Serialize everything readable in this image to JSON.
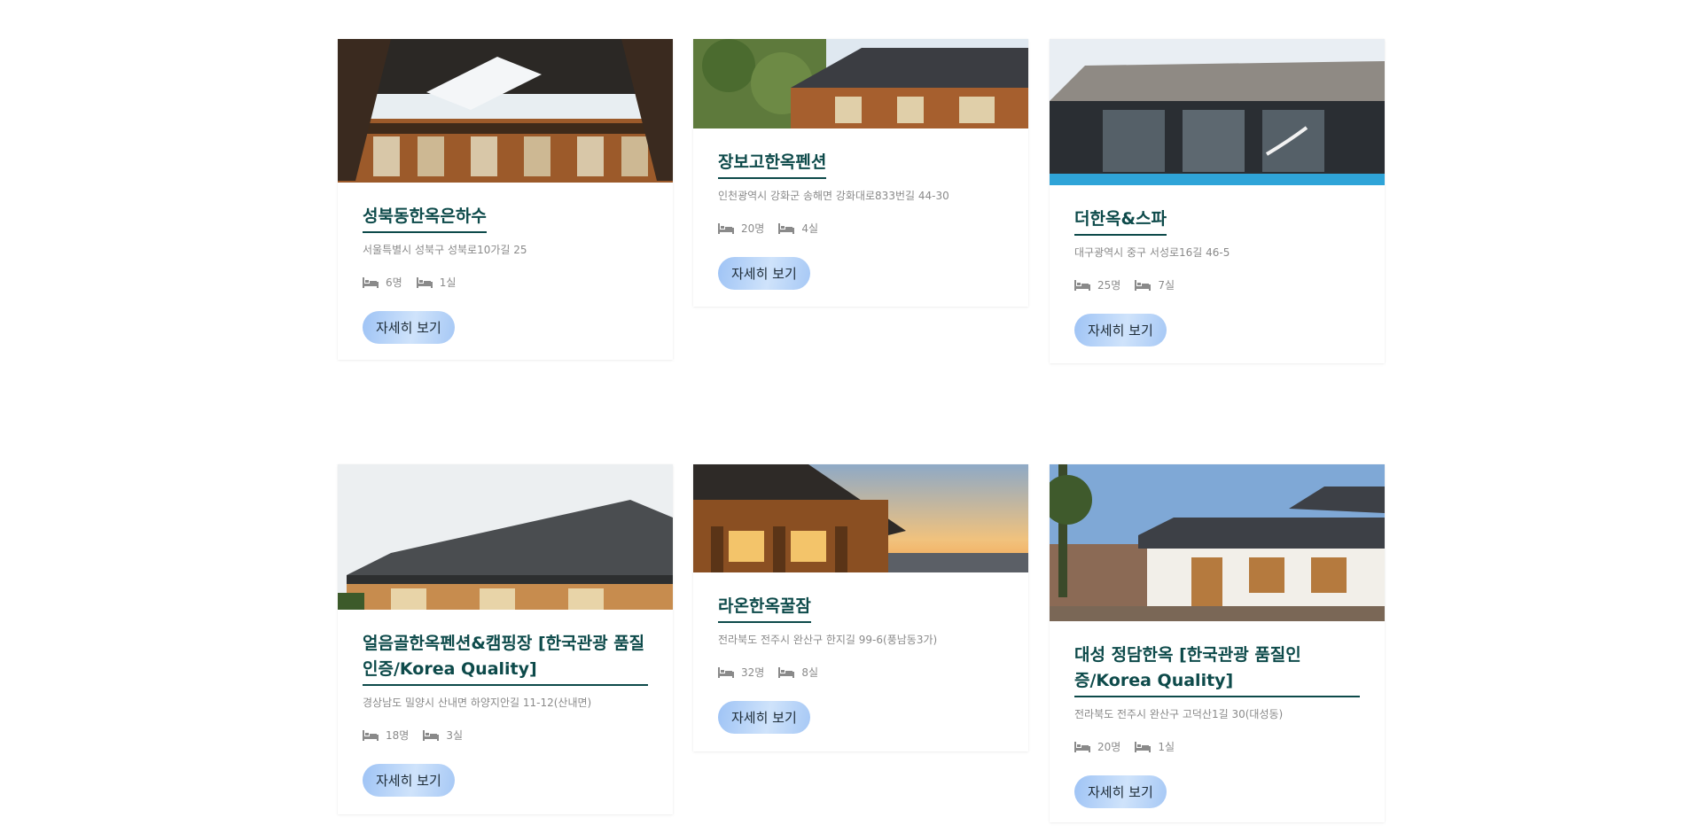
{
  "listings": [
    {
      "name": "성북동한옥은하수",
      "address": "서울특별시 성북구 성북로10가길 25",
      "guests": "6명",
      "rooms": "1실",
      "button": "자세히 보기"
    },
    {
      "name": "장보고한옥펜션",
      "address": "인천광역시 강화군 송해면 강화대로833번길 44-30",
      "guests": "20명",
      "rooms": "4실",
      "button": "자세히 보기"
    },
    {
      "name": "더한옥&스파",
      "address": "대구광역시 중구 서성로16길 46-5",
      "guests": "25명",
      "rooms": "7실",
      "button": "자세히 보기"
    },
    {
      "name": "얼음골한옥펜션&캠핑장 [한국관광 품질인증/Korea Quality]",
      "address": "경상남도 밀양시 산내면 하양지안길 11-12(산내면)",
      "guests": "18명",
      "rooms": "3실",
      "button": "자세히 보기"
    },
    {
      "name": "라온한옥꿀잠",
      "address": "전라북도 전주시 완산구 한지길 99-6(풍남동3가)",
      "guests": "32명",
      "rooms": "8실",
      "button": "자세히 보기"
    },
    {
      "name": "대성 정담한옥 [한국관광 품질인증/Korea Quality]",
      "address": "전라북도 전주시 완산구 고덕산1길 30(대성동)",
      "guests": "20명",
      "rooms": "1실",
      "button": "자세히 보기"
    }
  ],
  "icons": {
    "guests": "bed-icon",
    "rooms": "bed-icon"
  },
  "colors": {
    "title": "#0d4a4a",
    "meta": "#8a8a8a",
    "button_start": "#9ec3f5",
    "button_end": "#cfe3fb"
  }
}
